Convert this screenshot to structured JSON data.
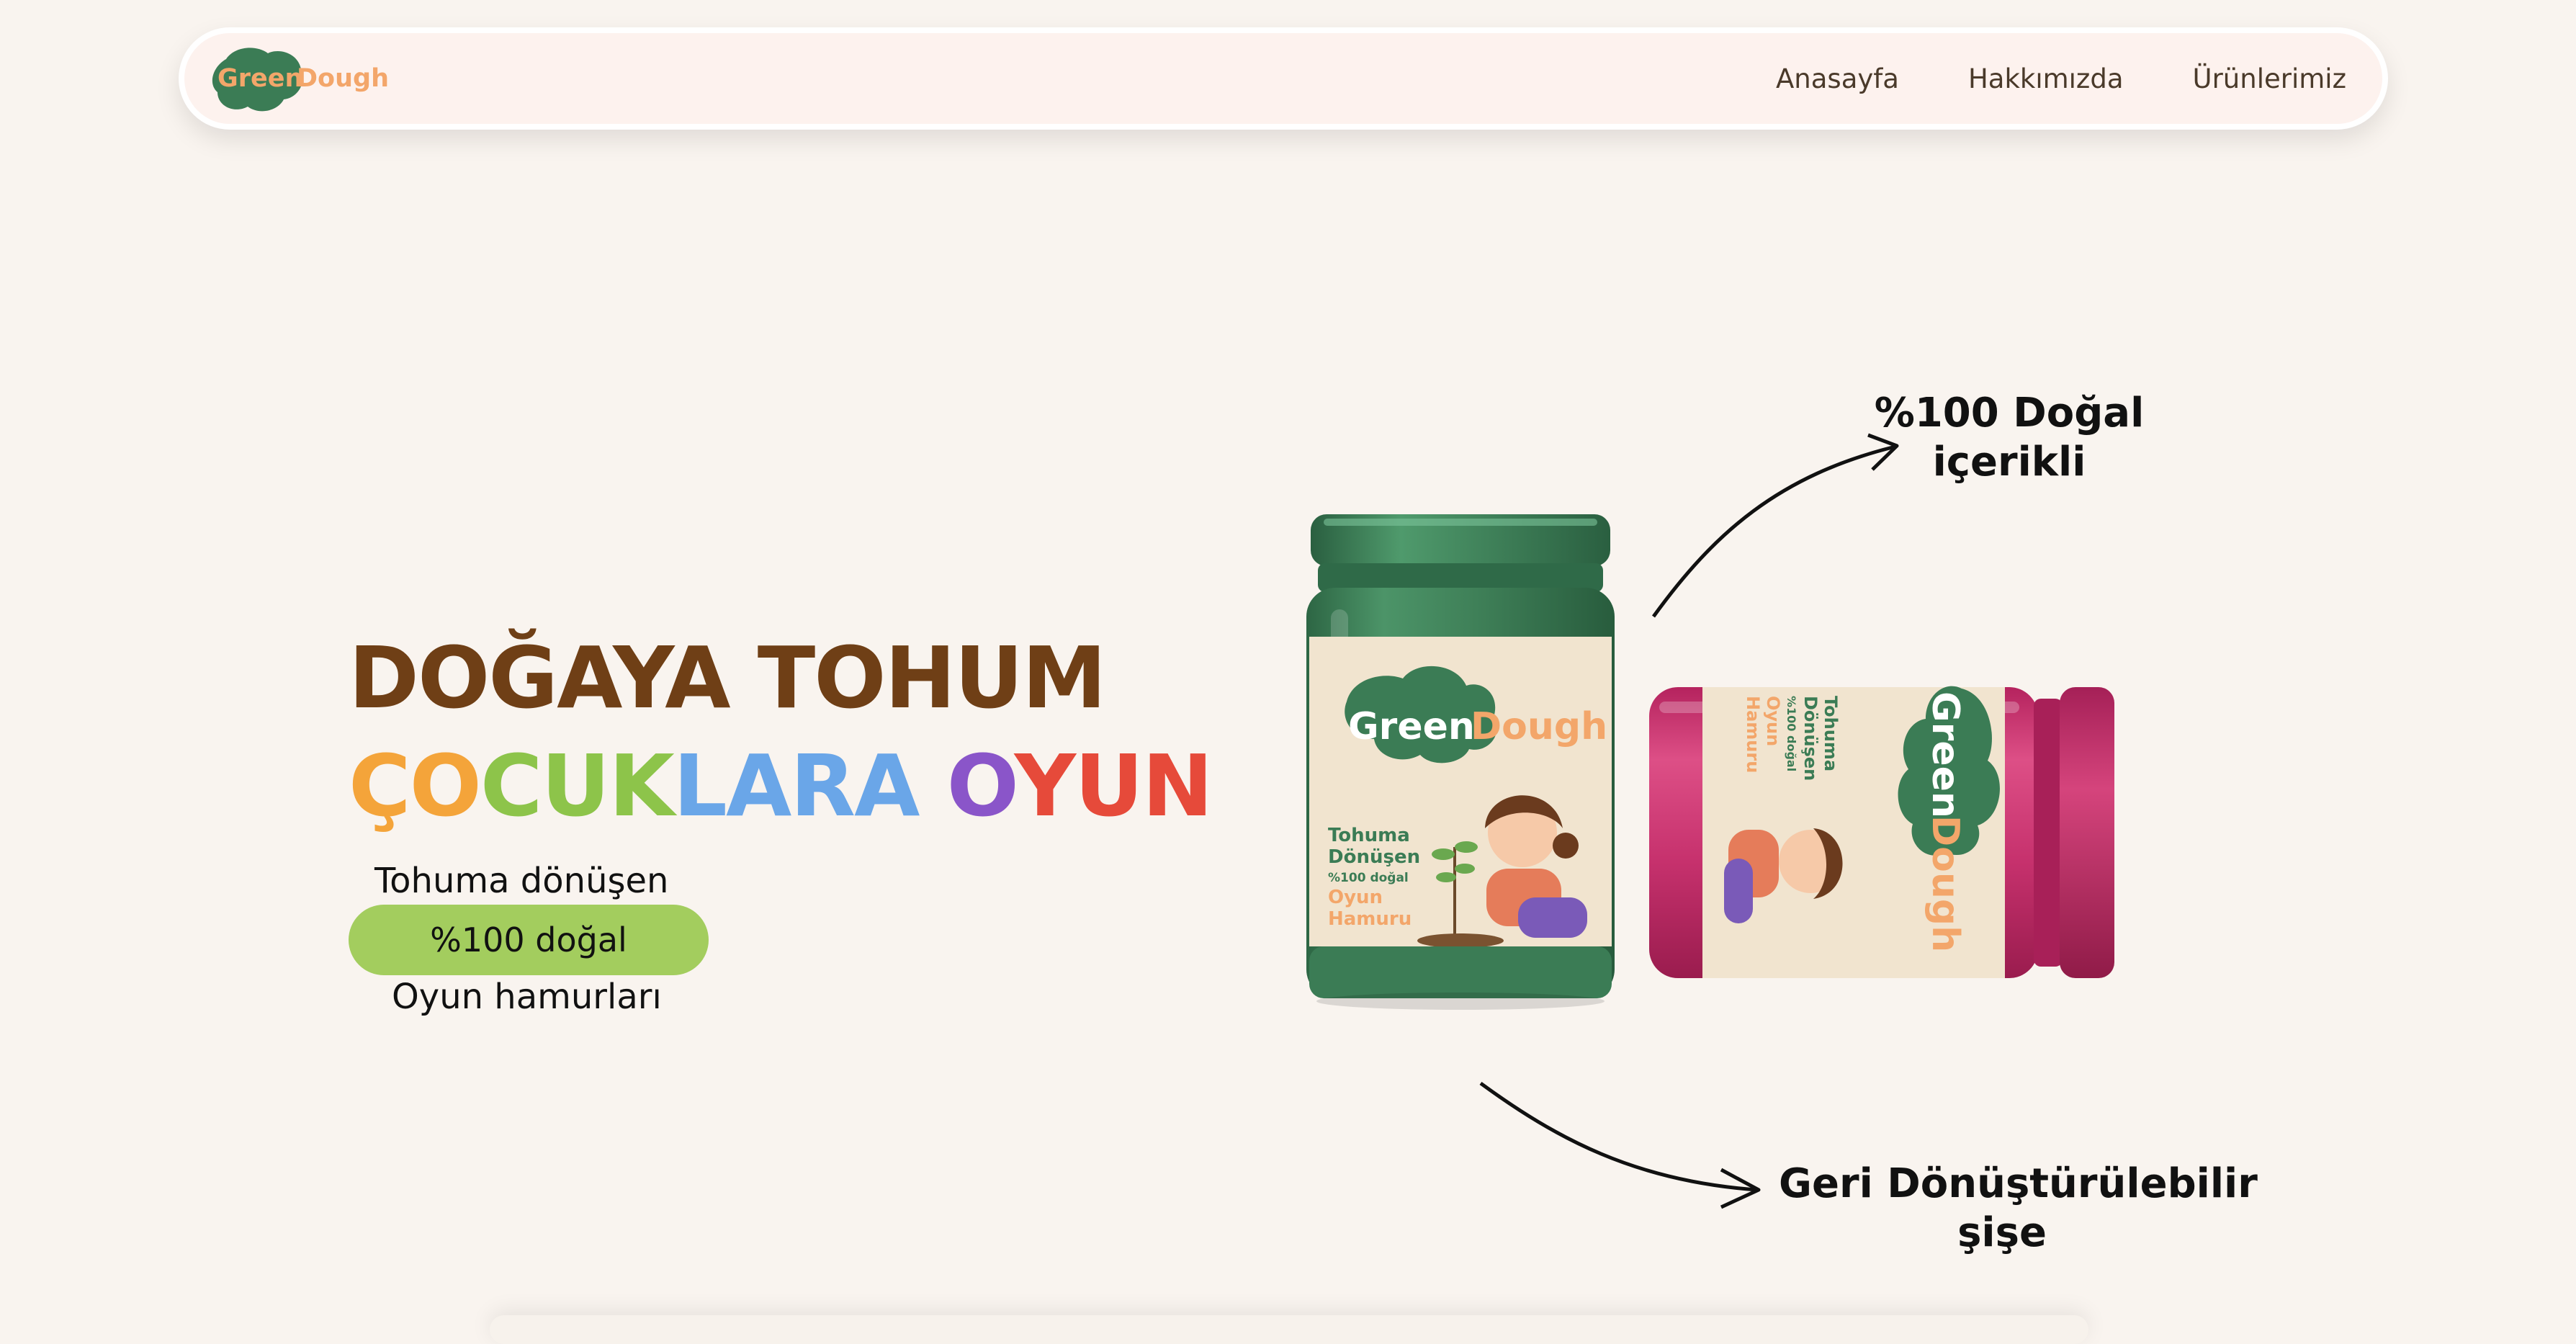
{
  "header": {
    "logo": {
      "part1": "Green",
      "part2": "Dough"
    },
    "nav": [
      {
        "label": "Anasayfa"
      },
      {
        "label": "Hakkımızda"
      },
      {
        "label": "Ürünlerimiz"
      }
    ]
  },
  "hero": {
    "line1": "DOĞAYA TOHUM",
    "line2": {
      "seg1": "ÇO",
      "seg2": "CUK",
      "seg3": "LARA ",
      "seg4": "O",
      "seg5": "YUN"
    },
    "tagline": {
      "top": "Tohuma dönüşen",
      "pill": "%100 doğal",
      "bottom": "Oyun hamurları"
    }
  },
  "jar_label": {
    "brand1": "Green",
    "brand2": "Dough",
    "line1": "Tohuma",
    "line2": "Dönüşen",
    "line3": "%100 doğal",
    "line4": "Oyun",
    "line5": "Hamuru"
  },
  "annotations": {
    "top_line1": "%100 Doğal",
    "top_line2": "içerikli",
    "bottom_line1": "Geri Dönüştürülebilir",
    "bottom_line2": "şişe"
  },
  "colors": {
    "background": "#f9f4ef",
    "headline_brown": "#6f3f16",
    "pill_green": "#a3cd5e",
    "jar_green": "#3f7f56",
    "jar_pink": "#c8306e",
    "logo_orange": "#f3a66a"
  }
}
